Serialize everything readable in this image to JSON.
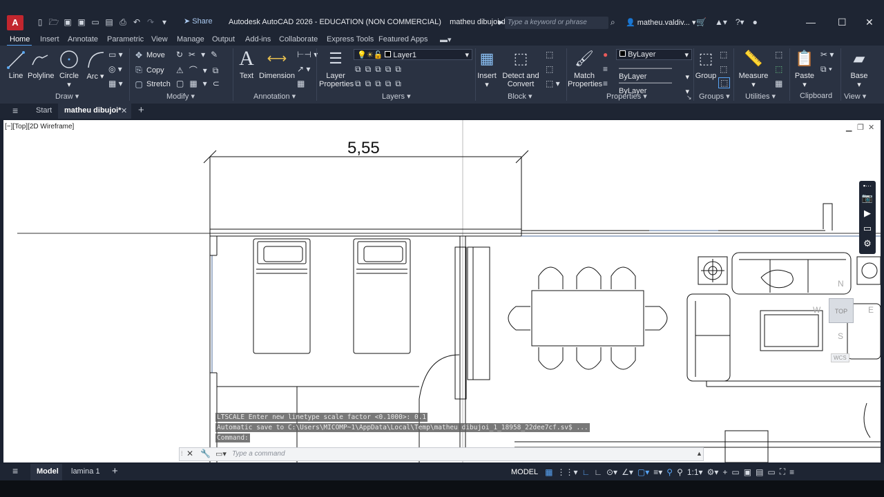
{
  "titlebar": {
    "app_letter": "A",
    "share_label": "Share",
    "title": "Autodesk AutoCAD 2026 - EDUCATION (NON COMMERCIAL)",
    "filename": "matheu dibujoi.dwg",
    "search_placeholder": "Type a keyword or phrase",
    "username": "matheu.valdiv...",
    "minimize": "—",
    "maximize": "☐",
    "close": "✕"
  },
  "menu_tabs": [
    "Home",
    "Insert",
    "Annotate",
    "Parametric",
    "View",
    "Manage",
    "Output",
    "Add-ins",
    "Collaborate",
    "Express Tools",
    "Featured Apps"
  ],
  "ribbon": {
    "draw": {
      "line": "Line",
      "polyline": "Polyline",
      "circle": "Circle",
      "arc": "Arc",
      "panel": "Draw"
    },
    "modify": {
      "move": "Move",
      "copy": "Copy",
      "stretch": "Stretch",
      "panel": "Modify"
    },
    "annotation": {
      "text": "Text",
      "dimension": "Dimension",
      "panel": "Annotation"
    },
    "layers": {
      "layer_properties_1": "Layer",
      "layer_properties_2": "Properties",
      "current_layer": "Layer1",
      "panel": "Layers"
    },
    "block": {
      "insert": "Insert",
      "detect_1": "Detect and",
      "detect_2": "Convert",
      "panel": "Block"
    },
    "properties": {
      "match_1": "Match",
      "match_2": "Properties",
      "color": "ByLayer",
      "lineweight": "ByLayer",
      "linetype": "ByLayer",
      "panel": "Properties"
    },
    "groups": {
      "group": "Group",
      "panel": "Groups"
    },
    "utilities": {
      "measure": "Measure",
      "panel": "Utilities"
    },
    "clipboard": {
      "paste": "Paste",
      "panel": "Clipboard"
    },
    "view": {
      "base": "Base",
      "panel": "View"
    }
  },
  "doc_tabs": {
    "start": "Start",
    "current": "matheu dibujoi*"
  },
  "viewport": {
    "label": "[−][Top][2D Wireframe]",
    "dimension_text": "5,55",
    "viewcube": {
      "n": "N",
      "s": "S",
      "e": "E",
      "w": "W",
      "face": "TOP",
      "wcs": "WCS"
    }
  },
  "command": {
    "history": [
      "LTSCALE Enter new linetype scale factor <0.1000>: 0.1",
      "Automatic save to C:\\Users\\MICOMP~1\\AppData\\Local\\Temp\\matheu dibujoi_1_18958_22dee7cf.sv$ ...",
      "Command:"
    ],
    "placeholder": "Type a command"
  },
  "status": {
    "model_tab": "Model",
    "layout_tab": "lamina 1",
    "model_space": "MODEL",
    "scale": "1:1"
  }
}
